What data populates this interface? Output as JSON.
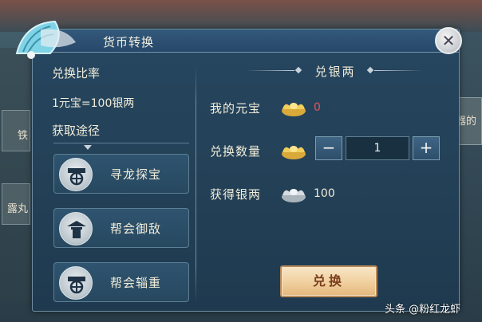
{
  "background": {
    "left_labels": [
      "铁",
      "露丸"
    ],
    "right_labels": [
      "器的"
    ]
  },
  "dialog": {
    "title": "货币转换",
    "close_label": "✕"
  },
  "left_panel": {
    "ratio_label": "兑换比率",
    "ratio_value": "1元宝=100银两",
    "source_label": "获取途径",
    "sources": [
      {
        "label": "寻龙探宝",
        "icon": "cart-wheel-icon"
      },
      {
        "label": "帮会御敌",
        "icon": "pavilion-icon"
      },
      {
        "label": "帮会辎重",
        "icon": "cart-wheel-icon"
      }
    ]
  },
  "right_panel": {
    "section_title": "兑银两",
    "my_yuanbao_label": "我的元宝",
    "my_yuanbao_value": "0",
    "exchange_qty_label": "兑换数量",
    "minus_label": "−",
    "qty_value": "1",
    "plus_label": "+",
    "obtain_silver_label": "获得银两",
    "obtain_silver_value": "100",
    "exchange_button": "兑换"
  },
  "watermark": "头条 @粉红龙虾",
  "colors": {
    "dialog_bg": "#244259",
    "accent_red": "#e2545b",
    "button_gold": "#f0cf9e",
    "gold_ingot": "#e8c24f",
    "silver_ingot": "#d5dbe0"
  }
}
